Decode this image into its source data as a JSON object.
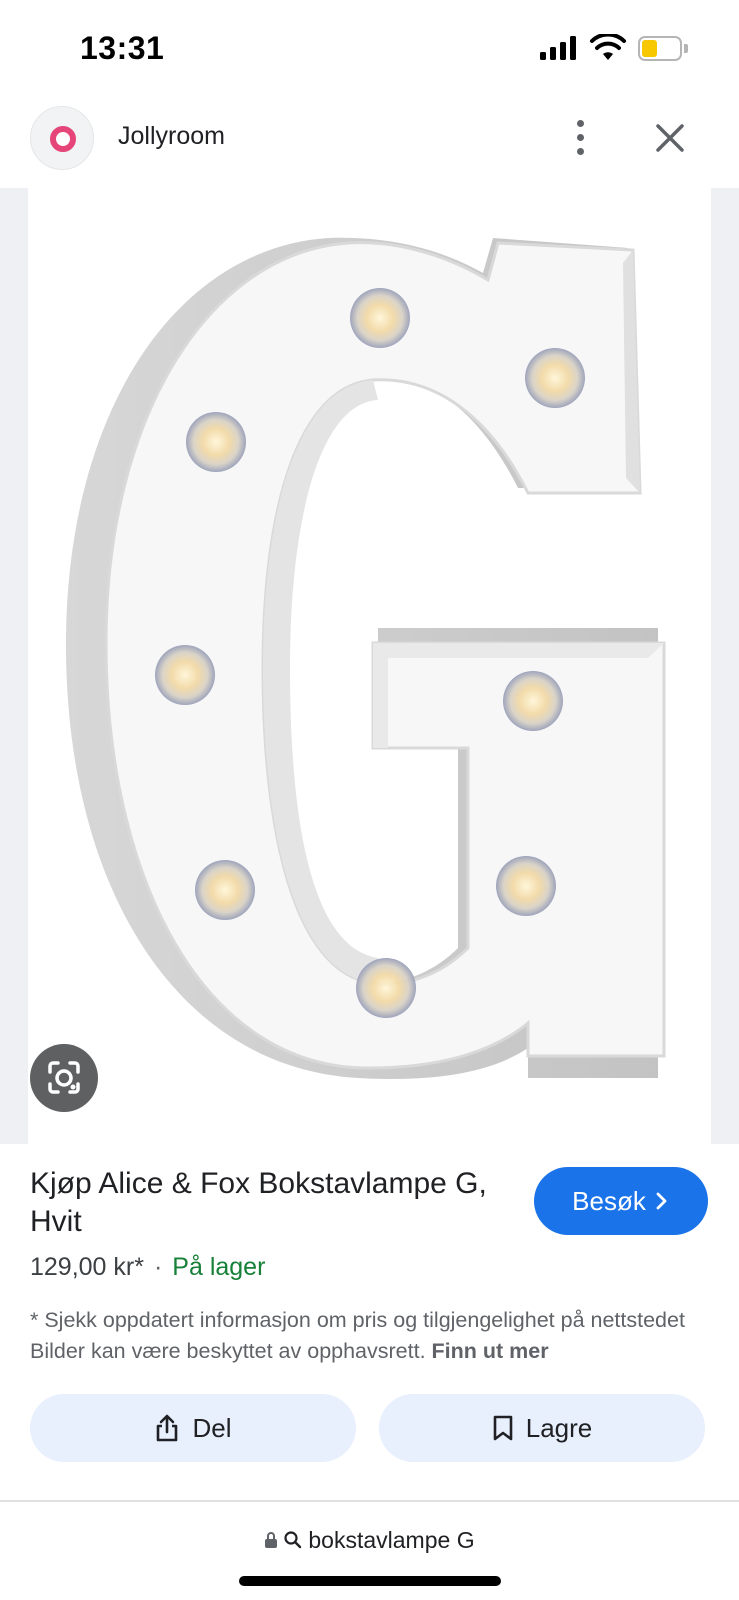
{
  "status_bar": {
    "time": "13:31",
    "icons": [
      "cellular-signal-icon",
      "wifi-icon",
      "battery-low-icon"
    ],
    "battery_color": "#f7c800"
  },
  "header": {
    "site_name": "Jollyroom",
    "logo_color": "#e6457a",
    "more_icon": "more-vertical-icon",
    "close_icon": "close-icon"
  },
  "image": {
    "subject": "G",
    "lens_icon": "google-lens-icon"
  },
  "product": {
    "title": "Kjøp Alice & Fox Bokstavlampe G, Hvit",
    "visit_label": "Besøk",
    "price": "129,00 kr*",
    "separator": "·",
    "availability": "På lager",
    "disclaimer": "* Sjekk oppdatert informasjon om pris og tilgjengelighet på nettstedet Bilder kan være beskyttet av opphavsrett.",
    "learn_more": "Finn ut mer"
  },
  "actions": {
    "share_label": "Del",
    "save_label": "Lagre"
  },
  "url_bar": {
    "query": "bokstavlampe G"
  },
  "colors": {
    "accent": "#1a73e8",
    "in_stock": "#188038",
    "action_bg": "#e8f0fe"
  }
}
